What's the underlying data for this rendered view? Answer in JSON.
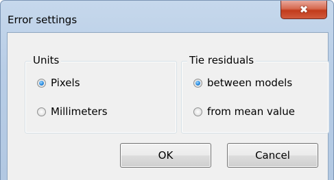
{
  "window": {
    "title": "Error settings",
    "close_icon": "✖"
  },
  "units": {
    "legend": "Units",
    "options": [
      {
        "label": "Pixels",
        "checked": true
      },
      {
        "label": "Millimeters",
        "checked": false
      }
    ]
  },
  "tie_residuals": {
    "legend": "Tie residuals",
    "options": [
      {
        "label": "between models",
        "checked": true
      },
      {
        "label": "from mean value",
        "checked": false
      }
    ]
  },
  "buttons": {
    "ok_label": "OK",
    "cancel_label": "Cancel"
  },
  "colors": {
    "title_bar": "#b8cde6",
    "close_button": "#c23b1c",
    "radio_selected": "#2a8ce0",
    "client_background": "#f0f0f0"
  }
}
